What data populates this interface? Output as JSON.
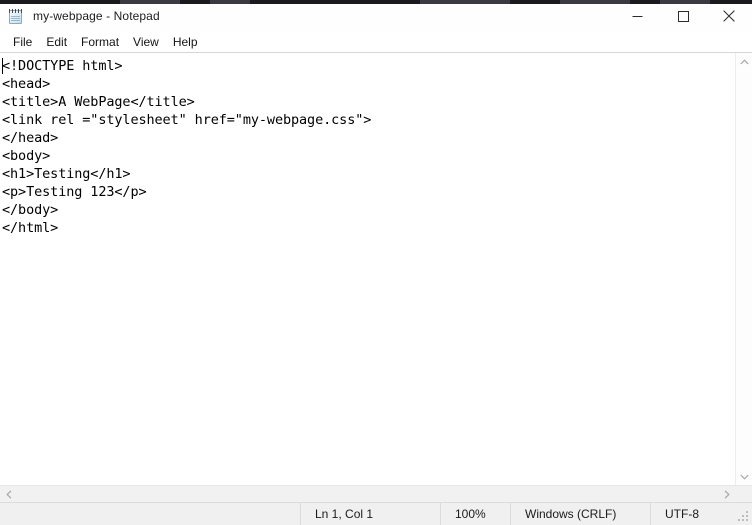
{
  "window": {
    "title": "my-webpage - Notepad",
    "icon": "notepad-icon",
    "controls": {
      "minimize": "minimize-icon",
      "maximize": "maximize-icon",
      "close": "close-icon"
    }
  },
  "menubar": {
    "items": [
      {
        "label": "File"
      },
      {
        "label": "Edit"
      },
      {
        "label": "Format"
      },
      {
        "label": "View"
      },
      {
        "label": "Help"
      }
    ]
  },
  "editor": {
    "content": "<!DOCTYPE html>\n<head>\n<title>A WebPage</title>\n<link rel =\"stylesheet\" href=\"my-webpage.css\">\n</head>\n<body>\n<h1>Testing</h1>\n<p>Testing 123</p>\n</body>\n</html>",
    "lines": [
      "<!DOCTYPE html>",
      "<head>",
      "<title>A WebPage</title>",
      "<link rel =\"stylesheet\" href=\"my-webpage.css\">",
      "</head>",
      "<body>",
      "<h1>Testing</h1>",
      "<p>Testing 123</p>",
      "</body>",
      "</html>"
    ],
    "caret_visible": true
  },
  "scrollbars": {
    "vertical": {
      "up_arrow": "chevron-up-icon",
      "down_arrow": "chevron-down-icon"
    },
    "horizontal": {
      "left_arrow": "chevron-left-icon",
      "right_arrow": "chevron-right-icon"
    }
  },
  "statusbar": {
    "cursor_position": "Ln 1, Col 1",
    "zoom": "100%",
    "line_ending": "Windows (CRLF)",
    "encoding": "UTF-8",
    "resize_grip": "resize-grip-icon"
  },
  "colors": {
    "titlebar_bg": "#fefefe",
    "menubar_bg": "#ffffff",
    "editor_bg": "#ffffff",
    "text": "#000000",
    "statusbar_bg": "#f0f0f0",
    "scrollbar_bg": "#f1f1f1",
    "divider": "#dcdcdc"
  }
}
